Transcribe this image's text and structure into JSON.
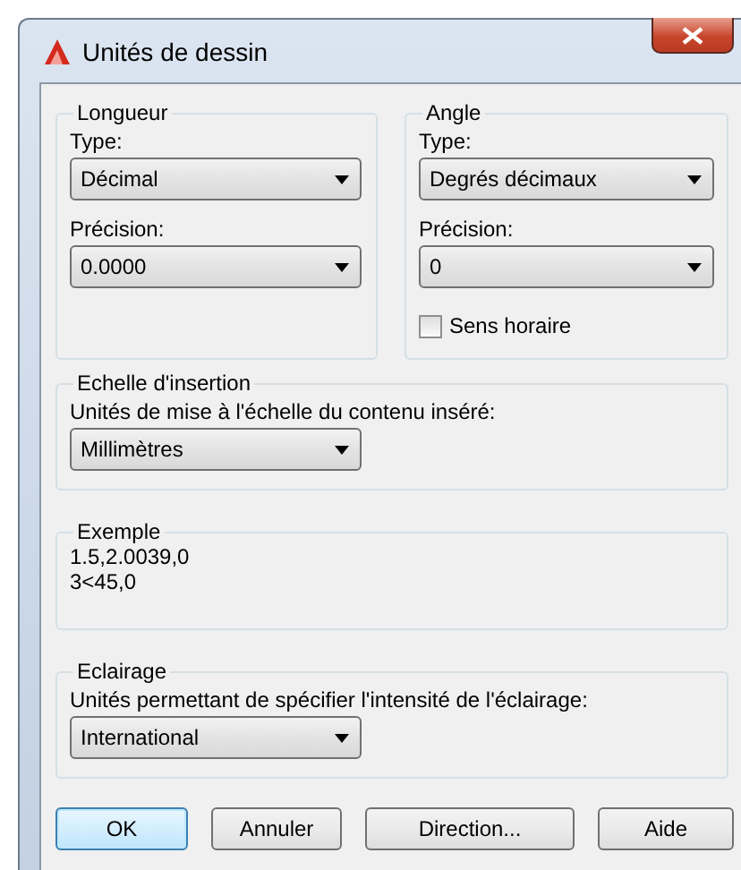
{
  "window": {
    "title": "Unités de dessin"
  },
  "length": {
    "legend": "Longueur",
    "type_label": "Type:",
    "type_value": "Décimal",
    "precision_label": "Précision:",
    "precision_value": "0.0000"
  },
  "angle": {
    "legend": "Angle",
    "type_label": "Type:",
    "type_value": "Degrés décimaux",
    "precision_label": "Précision:",
    "precision_value": "0",
    "clockwise": {
      "label": "Sens horaire",
      "checked": false
    }
  },
  "insertion_scale": {
    "legend": "Echelle d'insertion",
    "label": "Unités de mise à l'échelle du contenu inséré:",
    "value": "Millimètres"
  },
  "sample": {
    "legend": "Exemple",
    "lines": [
      "1.5,2.0039,0",
      "3<45,0"
    ]
  },
  "lighting": {
    "legend": "Eclairage",
    "label": "Unités permettant de spécifier l'intensité de l'éclairage:",
    "value": "International"
  },
  "buttons": [
    {
      "label": "OK",
      "default": true
    },
    {
      "label": "Annuler",
      "default": false
    },
    {
      "label": "Direction...",
      "default": false
    },
    {
      "label": "Aide",
      "default": false
    }
  ]
}
